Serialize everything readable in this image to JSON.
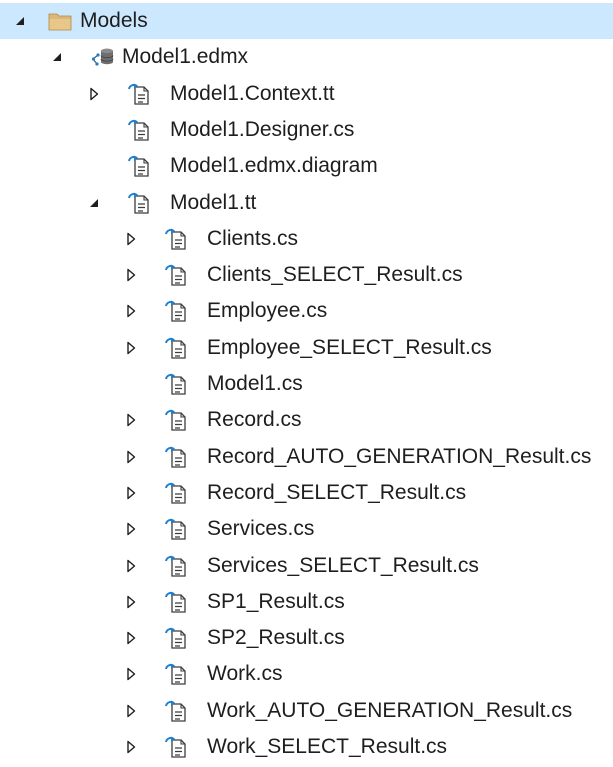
{
  "nodes": [
    {
      "label": "Models",
      "depth": 0,
      "expander": "expanded",
      "icon": "folder-icon",
      "selected": true
    },
    {
      "label": "Model1.edmx",
      "depth": 1,
      "expander": "expanded",
      "icon": "edmx-model-icon"
    },
    {
      "label": "Model1.Context.tt",
      "depth": 2,
      "expander": "collapsed",
      "icon": "template-file-icon"
    },
    {
      "label": "Model1.Designer.cs",
      "depth": 2,
      "expander": "none",
      "icon": "template-file-icon"
    },
    {
      "label": "Model1.edmx.diagram",
      "depth": 2,
      "expander": "none",
      "icon": "template-file-icon"
    },
    {
      "label": "Model1.tt",
      "depth": 2,
      "expander": "expanded",
      "icon": "template-file-icon"
    },
    {
      "label": "Clients.cs",
      "depth": 3,
      "expander": "collapsed",
      "icon": "template-file-icon"
    },
    {
      "label": "Clients_SELECT_Result.cs",
      "depth": 3,
      "expander": "collapsed",
      "icon": "template-file-icon"
    },
    {
      "label": "Employee.cs",
      "depth": 3,
      "expander": "collapsed",
      "icon": "template-file-icon"
    },
    {
      "label": "Employee_SELECT_Result.cs",
      "depth": 3,
      "expander": "collapsed",
      "icon": "template-file-icon"
    },
    {
      "label": "Model1.cs",
      "depth": 3,
      "expander": "none",
      "icon": "template-file-icon"
    },
    {
      "label": "Record.cs",
      "depth": 3,
      "expander": "collapsed",
      "icon": "template-file-icon"
    },
    {
      "label": "Record_AUTO_GENERATION_Result.cs",
      "depth": 3,
      "expander": "collapsed",
      "icon": "template-file-icon"
    },
    {
      "label": "Record_SELECT_Result.cs",
      "depth": 3,
      "expander": "collapsed",
      "icon": "template-file-icon"
    },
    {
      "label": "Services.cs",
      "depth": 3,
      "expander": "collapsed",
      "icon": "template-file-icon"
    },
    {
      "label": "Services_SELECT_Result.cs",
      "depth": 3,
      "expander": "collapsed",
      "icon": "template-file-icon"
    },
    {
      "label": "SP1_Result.cs",
      "depth": 3,
      "expander": "collapsed",
      "icon": "template-file-icon"
    },
    {
      "label": "SP2_Result.cs",
      "depth": 3,
      "expander": "collapsed",
      "icon": "template-file-icon"
    },
    {
      "label": "Work.cs",
      "depth": 3,
      "expander": "collapsed",
      "icon": "template-file-icon"
    },
    {
      "label": "Work_AUTO_GENERATION_Result.cs",
      "depth": 3,
      "expander": "collapsed",
      "icon": "template-file-icon"
    },
    {
      "label": "Work_SELECT_Result.cs",
      "depth": 3,
      "expander": "collapsed",
      "icon": "template-file-icon"
    }
  ],
  "colors": {
    "selection": "#cce8ff",
    "text": "#1e1e1e",
    "expander": "#1e1e1e",
    "folder": "#dcb67a",
    "file_arrow": "#1e7fd0"
  }
}
